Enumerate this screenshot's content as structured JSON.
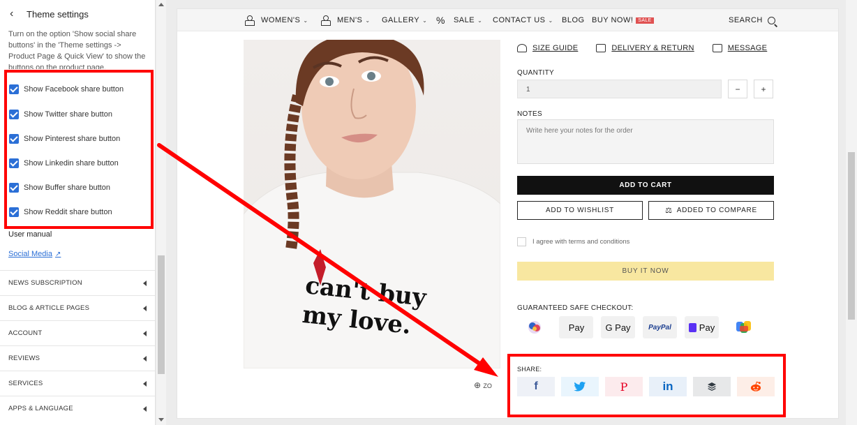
{
  "sidebar": {
    "title": "Theme settings",
    "description": "Turn on the option 'Show social share buttons' in the 'Theme settings -> Product Page & Quick View' to show the buttons on the product page.",
    "checkboxes": [
      {
        "label": "Show Facebook share button",
        "checked": true
      },
      {
        "label": "Show Twitter share button",
        "checked": true
      },
      {
        "label": "Show Pinterest share button",
        "checked": true
      },
      {
        "label": "Show Linkedin share button",
        "checked": true
      },
      {
        "label": "Show Buffer share button",
        "checked": true
      },
      {
        "label": "Show Reddit share button",
        "checked": true
      }
    ],
    "user_manual": "User manual",
    "social_link": "Social Media",
    "sections": [
      "NEWS SUBSCRIPTION",
      "BLOG & ARTICLE PAGES",
      "ACCOUNT",
      "REVIEWS",
      "SERVICES",
      "APPS & LANGUAGE"
    ]
  },
  "nav": {
    "items": [
      "WOMEN'S",
      "MEN'S",
      "GALLERY",
      "SALE",
      "CONTACT US",
      "BLOG",
      "BUY NOW!"
    ],
    "sale_badge": "SALE",
    "search": "SEARCH"
  },
  "product": {
    "shirt_text_line1": "can't buy",
    "shirt_text_line2": "my love.",
    "zoom_label": "ZO",
    "links": [
      "SIZE GUIDE",
      "DELIVERY & RETURN",
      "MESSAGE"
    ],
    "quantity_label": "QUANTITY",
    "quantity_value": "1",
    "minus": "−",
    "plus": "+",
    "notes_label": "NOTES",
    "notes_placeholder": "Write here your notes for the order",
    "add_to_cart": "ADD TO CART",
    "add_to_wishlist": "ADD TO WISHLIST",
    "added_to_compare": "ADDED TO COMPARE",
    "agree": "I agree with terms and conditions",
    "buy_now": "BUY IT NOW",
    "checkout_label": "GUARANTEED SAFE CHECKOUT:",
    "payments": [
      "Pay",
      "G Pay",
      "PayPal",
      "Pay"
    ],
    "share_label": "SHARE:"
  },
  "colors": {
    "accent": "#2b6fd6",
    "highlight": "#ff0000",
    "facebook": "#3b5998",
    "twitter": "#1da1f2",
    "pinterest": "#e60023",
    "linkedin": "#0a66c2",
    "buffer": "#323b43",
    "reddit": "#ff4500"
  }
}
